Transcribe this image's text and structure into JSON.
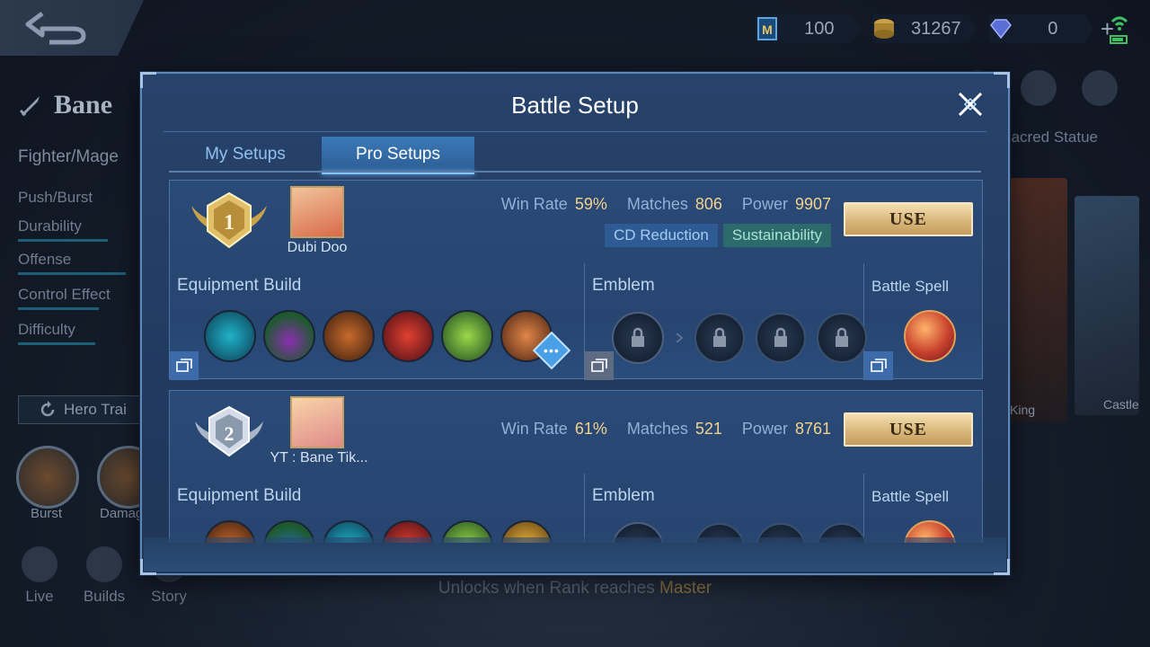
{
  "top_bar": {
    "ticket_value": "100",
    "gold_value": "31267",
    "diamond_value": "0",
    "plus_label": "+"
  },
  "hero": {
    "name": "Bane",
    "role": "Fighter/Mage",
    "specialty": "Push/Burst",
    "stats": [
      "Durability",
      "Offense",
      "Control Effect",
      "Difficulty"
    ],
    "hero_train_label": "Hero Trai",
    "skill_labels": [
      "Burst",
      "Damag"
    ]
  },
  "bottom_nav": [
    "Live",
    "Builds",
    "Story"
  ],
  "right_panel": {
    "sacred_label": "Sacred Statue",
    "skin_labels": [
      "King",
      "Castle"
    ]
  },
  "unlock_note": {
    "prefix": "Unlocks when Rank reaches ",
    "rank": "Master"
  },
  "modal": {
    "title": "Battle Setup",
    "tabs": [
      {
        "label": "My Setups",
        "active": false
      },
      {
        "label": "Pro Setups",
        "active": true
      }
    ],
    "labels": {
      "win_rate": "Win Rate",
      "matches": "Matches",
      "power": "Power",
      "use": "USE",
      "equipment": "Equipment Build",
      "emblem": "Emblem",
      "spell": "Battle Spell"
    },
    "setups": [
      {
        "rank": "1",
        "player": "Dubi Doo",
        "win_rate": "59%",
        "matches": "806",
        "power": "9907",
        "tags": [
          "CD Reduction",
          "Sustainability"
        ]
      },
      {
        "rank": "2",
        "player": "YT : Bane Tik...",
        "win_rate": "61%",
        "matches": "521",
        "power": "8761",
        "tags": []
      }
    ]
  },
  "colors": {
    "accent_gold": "#f3d28b",
    "modal_bg": "#27436c",
    "tab_active": "#3c7ab8"
  }
}
